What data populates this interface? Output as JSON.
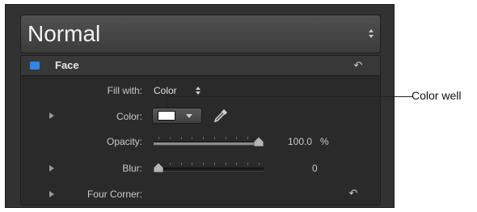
{
  "preset": {
    "label": "Normal"
  },
  "section": {
    "title": "Face",
    "enabled_color": "#2e86e6"
  },
  "fill_with": {
    "label": "Fill with:",
    "value": "Color"
  },
  "color": {
    "label": "Color:",
    "swatch_color": "#ffffff"
  },
  "opacity": {
    "label": "Opacity:",
    "value": "100.0",
    "unit": "%",
    "level_fraction": 1.0
  },
  "blur": {
    "label": "Blur:",
    "value": "0",
    "level_fraction": 0.0
  },
  "four_corner": {
    "label": "Four Corner:"
  },
  "callout": {
    "text": "Color well"
  },
  "icons": {
    "reset": "reset-arrow-icon",
    "eyedropper": "eyedropper-icon",
    "disclosure": "disclosure-triangle-icon"
  }
}
